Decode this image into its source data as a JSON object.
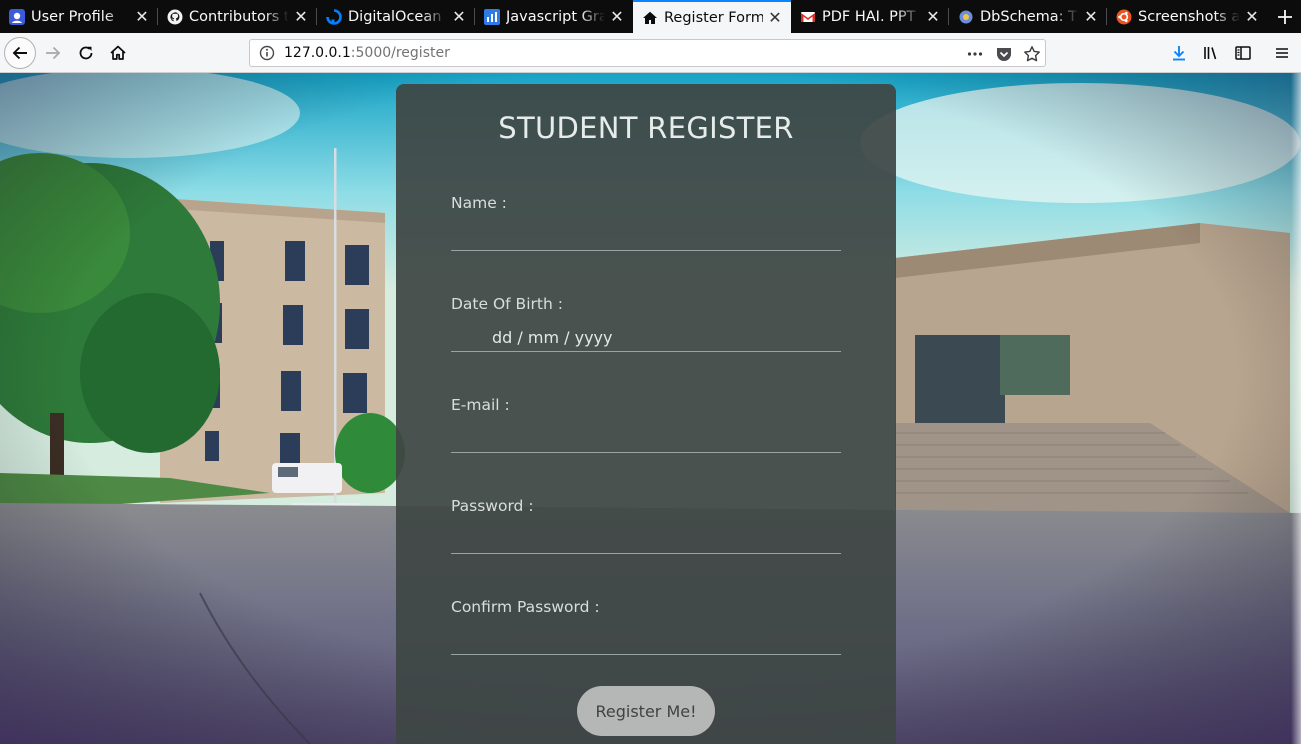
{
  "browser": {
    "tabs": [
      {
        "title": "User Profile",
        "icon": "user-profile-favicon",
        "active": false
      },
      {
        "title": "Contributors to",
        "icon": "github-icon",
        "active": false
      },
      {
        "title": "DigitalOcean - C",
        "icon": "digitalocean-icon",
        "active": false
      },
      {
        "title": "Javascript Graph",
        "icon": "chart-favicon",
        "active": false
      },
      {
        "title": "Register Form",
        "icon": "home-icon",
        "active": true
      },
      {
        "title": "PDF HAI. PPT H",
        "icon": "gmail-icon",
        "active": false
      },
      {
        "title": "DbSchema: The",
        "icon": "dbschema-icon",
        "active": false
      },
      {
        "title": "Screenshots a",
        "icon": "ubuntu-icon",
        "active": false
      }
    ],
    "url_host": "127.0.0.1",
    "url_path": ":5000/register",
    "accent_color": "#0a84ff"
  },
  "form": {
    "title": "STUDENT REGISTER",
    "name_label": "Name :",
    "dob_label": "Date Of Birth :",
    "dob_placeholder": "dd / mm / yyyy",
    "email_label": "E-mail :",
    "password_label": "Password :",
    "confirm_label": "Confirm Password :",
    "submit_label": "Register Me!"
  }
}
